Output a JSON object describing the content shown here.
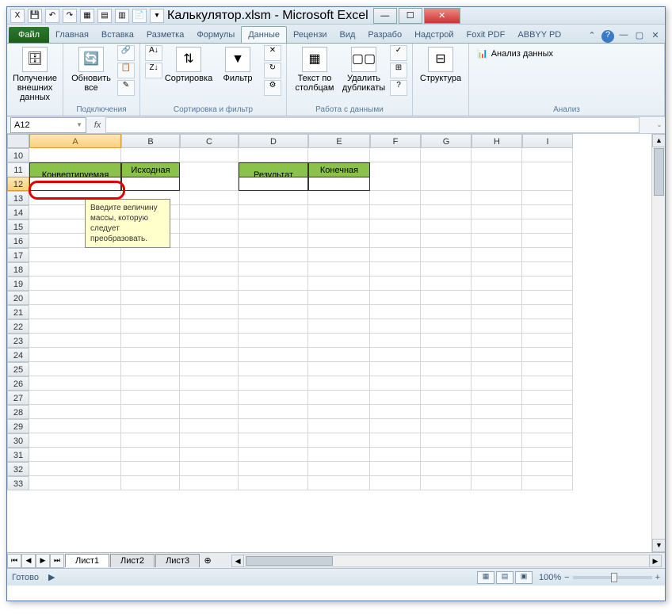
{
  "window": {
    "title": "Калькулятор.xlsm  -  Microsoft Excel"
  },
  "tabs": {
    "file": "Файл",
    "items": [
      "Главная",
      "Вставка",
      "Разметка",
      "Формулы",
      "Данные",
      "Рецензи",
      "Вид",
      "Разрабо",
      "Надстрой",
      "Foxit PDF",
      "ABBYY PD"
    ],
    "active_index": 4
  },
  "ribbon": {
    "get_data": "Получение\nвнешних данных",
    "refresh": "Обновить\nвсе",
    "connections_group": "Подключения",
    "sort": "Сортировка",
    "filter": "Фильтр",
    "sort_filter_group": "Сортировка и фильтр",
    "text_to_cols": "Текст по\nстолбцам",
    "remove_dupes": "Удалить\nдубликаты",
    "data_tools_group": "Работа с данными",
    "structure": "Структура",
    "analysis_btn": "Анализ данных",
    "analysis_group": "Анализ"
  },
  "namebox": "A12",
  "formula": "",
  "columns": [
    "A",
    "B",
    "C",
    "D",
    "E",
    "F",
    "G",
    "H",
    "I"
  ],
  "rows_start": 10,
  "rows_end": 33,
  "headers": {
    "a11": "Конвертируемая величина",
    "b11": "Исходная единица измерения",
    "d11": "Результат конвертаиции",
    "e11": "Конечная единица измерения"
  },
  "tooltip": "Введите величину массы, которую следует преобразовать.",
  "sheets": [
    "Лист1",
    "Лист2",
    "Лист3"
  ],
  "active_sheet": 0,
  "status": {
    "ready": "Готово",
    "zoom": "100%"
  }
}
